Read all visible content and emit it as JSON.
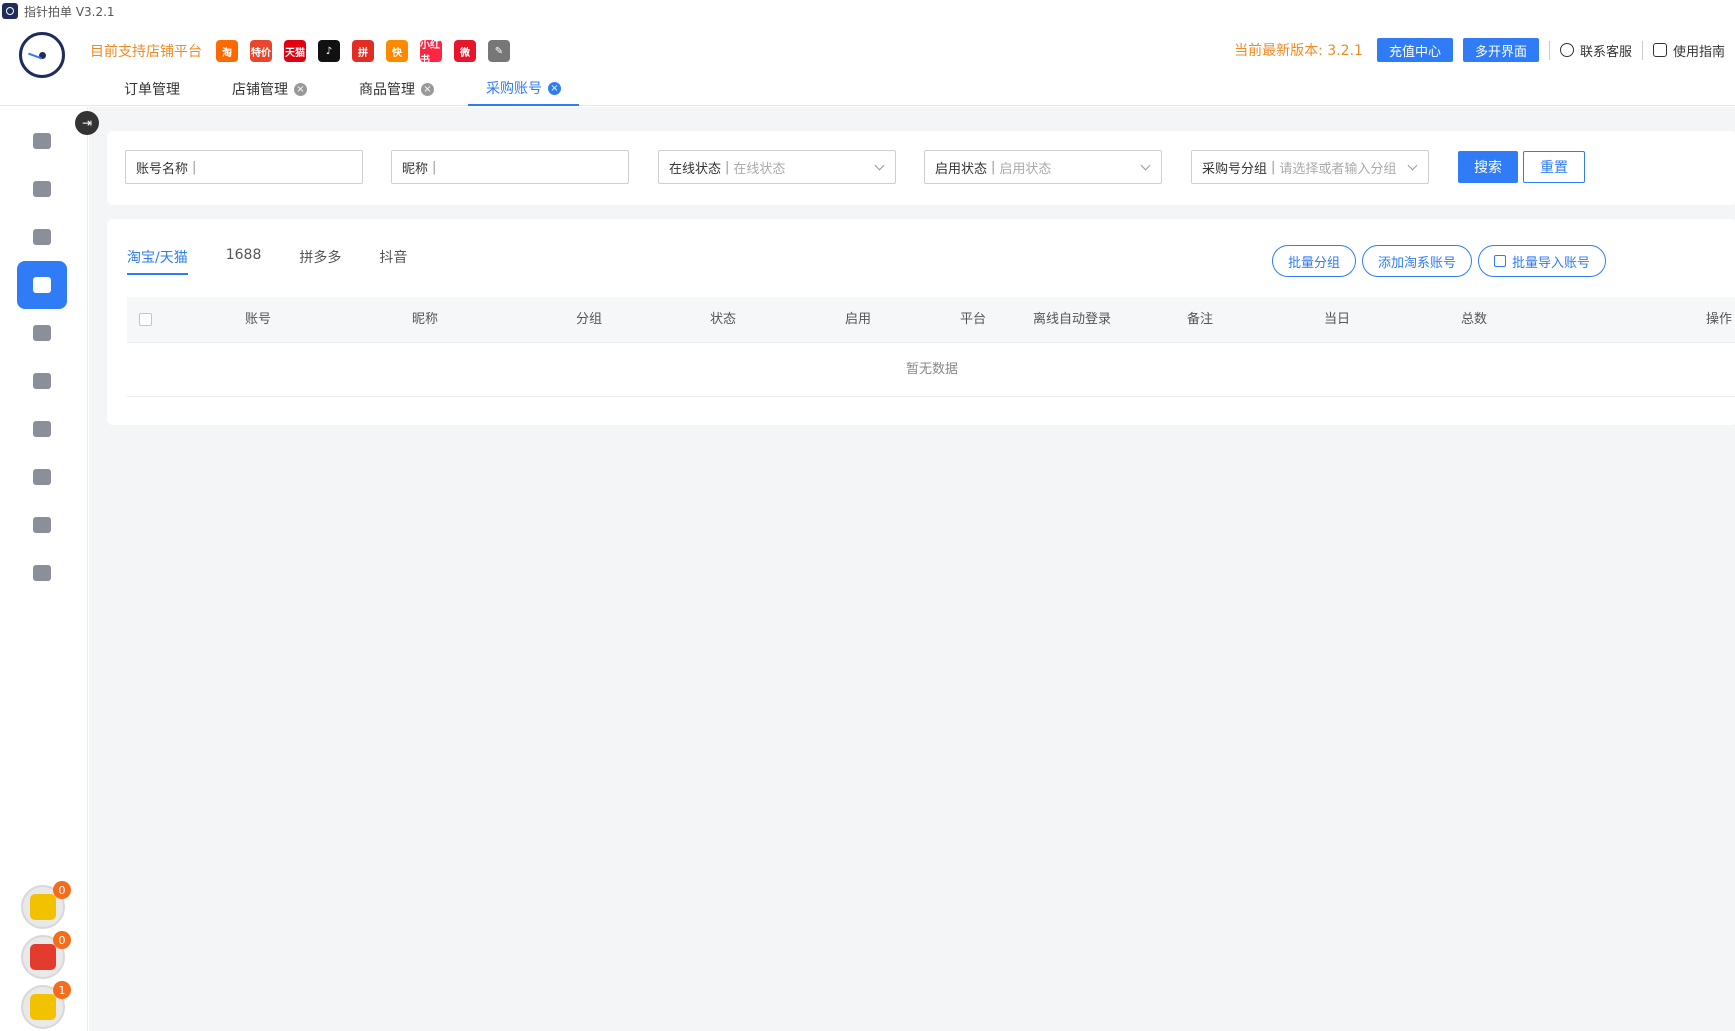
{
  "window": {
    "title": "指针拍单 V3.2.1"
  },
  "header": {
    "support_label": "目前支持店铺平台",
    "platforms": [
      {
        "name": "taobao",
        "glyph": "淘",
        "color": "#ff6a00"
      },
      {
        "name": "taote",
        "glyph": "特价",
        "color": "#e8472d"
      },
      {
        "name": "tmall",
        "glyph": "天猫",
        "color": "#e00012"
      },
      {
        "name": "douyin",
        "glyph": "♪",
        "color": "#111111"
      },
      {
        "name": "pinduoduo",
        "glyph": "拼",
        "color": "#e02e24"
      },
      {
        "name": "kuaishou",
        "glyph": "快",
        "color": "#ff8a00"
      },
      {
        "name": "xiaohongshu",
        "glyph": "小红书",
        "color": "#ff2442"
      },
      {
        "name": "weidian",
        "glyph": "微",
        "color": "#e8162b"
      },
      {
        "name": "other",
        "glyph": "✎",
        "color": "#777777"
      }
    ],
    "version_text": "当前最新版本: 3.2.1",
    "recharge": "充值中心",
    "multi_open": "多开界面",
    "contact": "联系客服",
    "guide": "使用指南"
  },
  "tabs": [
    {
      "label": "订单管理",
      "closable": false,
      "active": false
    },
    {
      "label": "店铺管理",
      "closable": true,
      "active": false
    },
    {
      "label": "商品管理",
      "closable": true,
      "active": false
    },
    {
      "label": "采购账号",
      "closable": true,
      "active": true
    }
  ],
  "sidebar": {
    "items": [
      {
        "name": "home",
        "active": false
      },
      {
        "name": "server",
        "active": false
      },
      {
        "name": "bag",
        "active": false
      },
      {
        "name": "accounts",
        "active": true
      },
      {
        "name": "support-agent",
        "active": false
      },
      {
        "name": "warehouse",
        "active": false
      },
      {
        "name": "pie-chart",
        "active": false
      },
      {
        "name": "trend",
        "active": false
      },
      {
        "name": "org",
        "active": false
      },
      {
        "name": "settings",
        "active": false
      }
    ],
    "badges": [
      {
        "name": "notes",
        "count": "0",
        "color": "#f2c200"
      },
      {
        "name": "truck",
        "count": "0",
        "color": "#e33b2e"
      },
      {
        "name": "megaphone",
        "count": "1",
        "color": "#f2c200"
      }
    ]
  },
  "filters": {
    "account_name": {
      "label": "账号名称",
      "placeholder": ""
    },
    "nickname": {
      "label": "昵称",
      "placeholder": ""
    },
    "online_status": {
      "label": "在线状态",
      "placeholder": "在线状态"
    },
    "enable_status": {
      "label": "启用状态",
      "placeholder": "启用状态"
    },
    "group": {
      "label": "采购号分组",
      "placeholder": "请选择或者输入分组"
    },
    "search": "搜索",
    "reset": "重置"
  },
  "platform_tabs": [
    "淘宝/天猫",
    "1688",
    "拼多多",
    "抖音"
  ],
  "actions": {
    "batch_group": "批量分组",
    "add_taobao": "添加淘系账号",
    "batch_import": "批量导入账号"
  },
  "table": {
    "columns": [
      "账号",
      "昵称",
      "分组",
      "状态",
      "启用",
      "平台",
      "离线自动登录",
      "备注",
      "当日",
      "总数",
      "操作"
    ],
    "empty_text": "暂无数据"
  }
}
